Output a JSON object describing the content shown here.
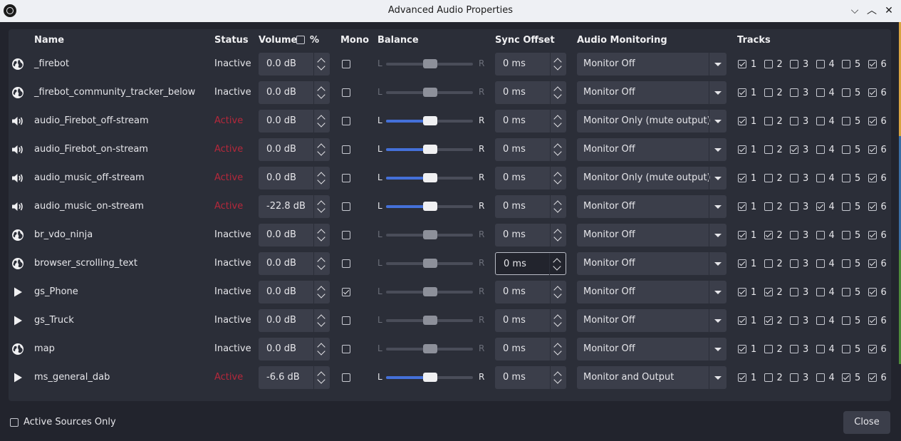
{
  "window": {
    "title": "Advanced Audio Properties",
    "min_glyph": "⌵",
    "max_glyph": "︿",
    "close_glyph": "✕"
  },
  "headers": {
    "name": "Name",
    "status": "Status",
    "volume": "Volume",
    "volume_percent": "%",
    "mono": "Mono",
    "balance": "Balance",
    "sync": "Sync Offset",
    "monitoring": "Audio Monitoring",
    "tracks": "Tracks"
  },
  "balance_labels": {
    "left": "L",
    "right": "R"
  },
  "track_numbers": [
    "1",
    "2",
    "3",
    "4",
    "5",
    "6"
  ],
  "colors": {
    "active_status": "#b5283b",
    "balance_fill": "#4470d9"
  },
  "rows": [
    {
      "icon": "browser-icon",
      "name": "_firebot",
      "status": "Inactive",
      "active": false,
      "volume": "0.0 dB",
      "mono": false,
      "sync": "0 ms",
      "monitoring": "Monitor Off",
      "tracks": [
        true,
        false,
        false,
        false,
        false,
        true
      ]
    },
    {
      "icon": "browser-icon",
      "name": "_firebot_community_tracker_below",
      "status": "Inactive",
      "active": false,
      "volume": "0.0 dB",
      "mono": false,
      "sync": "0 ms",
      "monitoring": "Monitor Off",
      "tracks": [
        true,
        false,
        false,
        false,
        false,
        true
      ]
    },
    {
      "icon": "speaker-icon",
      "name": "audio_Firebot_off-stream",
      "status": "Active",
      "active": true,
      "volume": "0.0 dB",
      "mono": false,
      "sync": "0 ms",
      "monitoring": "Monitor Only (mute output)",
      "tracks": [
        true,
        false,
        false,
        false,
        false,
        true
      ]
    },
    {
      "icon": "speaker-icon",
      "name": "audio_Firebot_on-stream",
      "status": "Active",
      "active": true,
      "volume": "0.0 dB",
      "mono": false,
      "sync": "0 ms",
      "monitoring": "Monitor Off",
      "tracks": [
        true,
        false,
        true,
        false,
        false,
        true
      ]
    },
    {
      "icon": "speaker-icon",
      "name": "audio_music_off-stream",
      "status": "Active",
      "active": true,
      "volume": "0.0 dB",
      "mono": false,
      "sync": "0 ms",
      "monitoring": "Monitor Only (mute output)",
      "tracks": [
        true,
        false,
        false,
        false,
        false,
        true
      ]
    },
    {
      "icon": "speaker-icon",
      "name": "audio_music_on-stream",
      "status": "Active",
      "active": true,
      "volume": "-22.8 dB",
      "mono": false,
      "sync": "0 ms",
      "monitoring": "Monitor Off",
      "tracks": [
        true,
        false,
        false,
        true,
        false,
        true
      ]
    },
    {
      "icon": "browser-icon",
      "name": "br_vdo_ninja",
      "status": "Inactive",
      "active": false,
      "volume": "0.0 dB",
      "mono": false,
      "sync": "0 ms",
      "monitoring": "Monitor Off",
      "tracks": [
        true,
        true,
        false,
        false,
        false,
        true
      ]
    },
    {
      "icon": "browser-icon",
      "name": "browser_scrolling_text",
      "status": "Inactive",
      "active": false,
      "volume": "0.0 dB",
      "mono": false,
      "sync": "0 ms",
      "sync_focused": true,
      "monitoring": "Monitor Off",
      "tracks": [
        true,
        false,
        false,
        false,
        false,
        true
      ]
    },
    {
      "icon": "play-icon",
      "name": "gs_Phone",
      "status": "Inactive",
      "active": false,
      "volume": "0.0 dB",
      "mono": true,
      "sync": "0 ms",
      "monitoring": "Monitor Off",
      "tracks": [
        true,
        true,
        false,
        false,
        false,
        true
      ]
    },
    {
      "icon": "play-icon",
      "name": "gs_Truck",
      "status": "Inactive",
      "active": false,
      "volume": "0.0 dB",
      "mono": false,
      "sync": "0 ms",
      "monitoring": "Monitor Off",
      "tracks": [
        true,
        true,
        false,
        false,
        false,
        true
      ]
    },
    {
      "icon": "browser-icon",
      "name": "map",
      "status": "Inactive",
      "active": false,
      "volume": "0.0 dB",
      "mono": false,
      "sync": "0 ms",
      "monitoring": "Monitor Off",
      "tracks": [
        true,
        false,
        false,
        false,
        false,
        true
      ]
    },
    {
      "icon": "play-icon",
      "name": "ms_general_dab",
      "status": "Active",
      "active": true,
      "volume": "-6.6 dB",
      "mono": false,
      "sync": "0 ms",
      "monitoring": "Monitor and Output",
      "tracks": [
        true,
        false,
        false,
        false,
        true,
        true
      ]
    }
  ],
  "footer": {
    "active_only_label": "Active Sources Only",
    "active_only_checked": false,
    "close_label": "Close"
  }
}
